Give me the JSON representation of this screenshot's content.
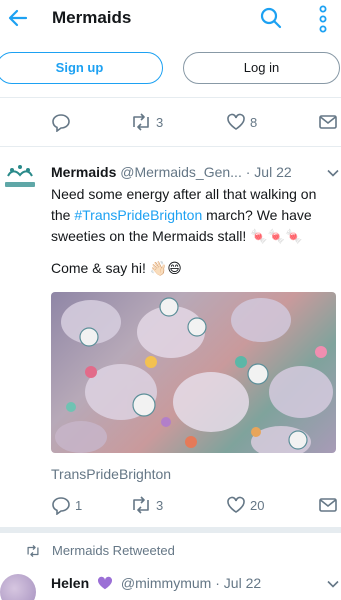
{
  "header": {
    "title": "Mermaids",
    "back_icon": "arrow-left-icon",
    "search_icon": "search-icon",
    "more_icon": "more-vertical-icon"
  },
  "auth": {
    "signup_label": "Sign up",
    "login_label": "Log in"
  },
  "prev_tweet_actions": {
    "reply_count": "",
    "retweet_count": "3",
    "like_count": "8"
  },
  "tweet": {
    "author_name": "Mermaids",
    "author_handle": "@Mermaids_Gen...",
    "separator": "·",
    "date": "Jul 22",
    "text_before": "Need some energy after all that walking on the ",
    "hashtag": "#TransPrideBrighton",
    "text_after": " march? We have sweeties on the Mermaids stall! 🍬🍬🍬",
    "text_line2": "Come & say hi! 👋🏻😄",
    "card_title": "TransPrideBrighton",
    "actions": {
      "reply_count": "1",
      "retweet_count": "3",
      "like_count": "20"
    }
  },
  "retweet_banner": {
    "text": "Mermaids Retweeted"
  },
  "tweet2": {
    "author_name": "Helen",
    "author_handle": "@mimmymum",
    "separator": "·",
    "date": "Jul 22"
  },
  "colors": {
    "accent": "#1da1f2",
    "muted": "#657786",
    "divider": "#e6ecf0",
    "heart_purple": "#9b6fd6"
  }
}
